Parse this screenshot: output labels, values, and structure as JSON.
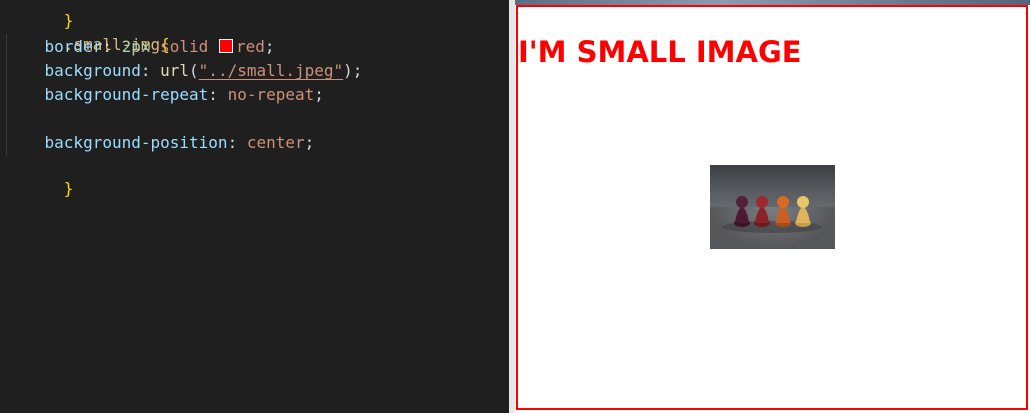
{
  "editor": {
    "lines": {
      "l0": "}",
      "l1_selector": ".small-img",
      "l1_brace": "{",
      "l2_prop": "border",
      "l2_num": "2px",
      "l2_solid": "solid",
      "l2_red": "red",
      "l3_prop": "background",
      "l3_func": "url",
      "l3_str": "\"../small.jpeg\"",
      "l4_prop": "background-repeat",
      "l4_val": "no-repeat",
      "l6_prop": "background-position",
      "l6_val": "center",
      "l7": "}"
    },
    "swatch_color": "#ff0000"
  },
  "preview": {
    "heading": "I'M SMALL IMAGE",
    "border_color": "#ff0000",
    "image_icon": "pawns-photo"
  }
}
